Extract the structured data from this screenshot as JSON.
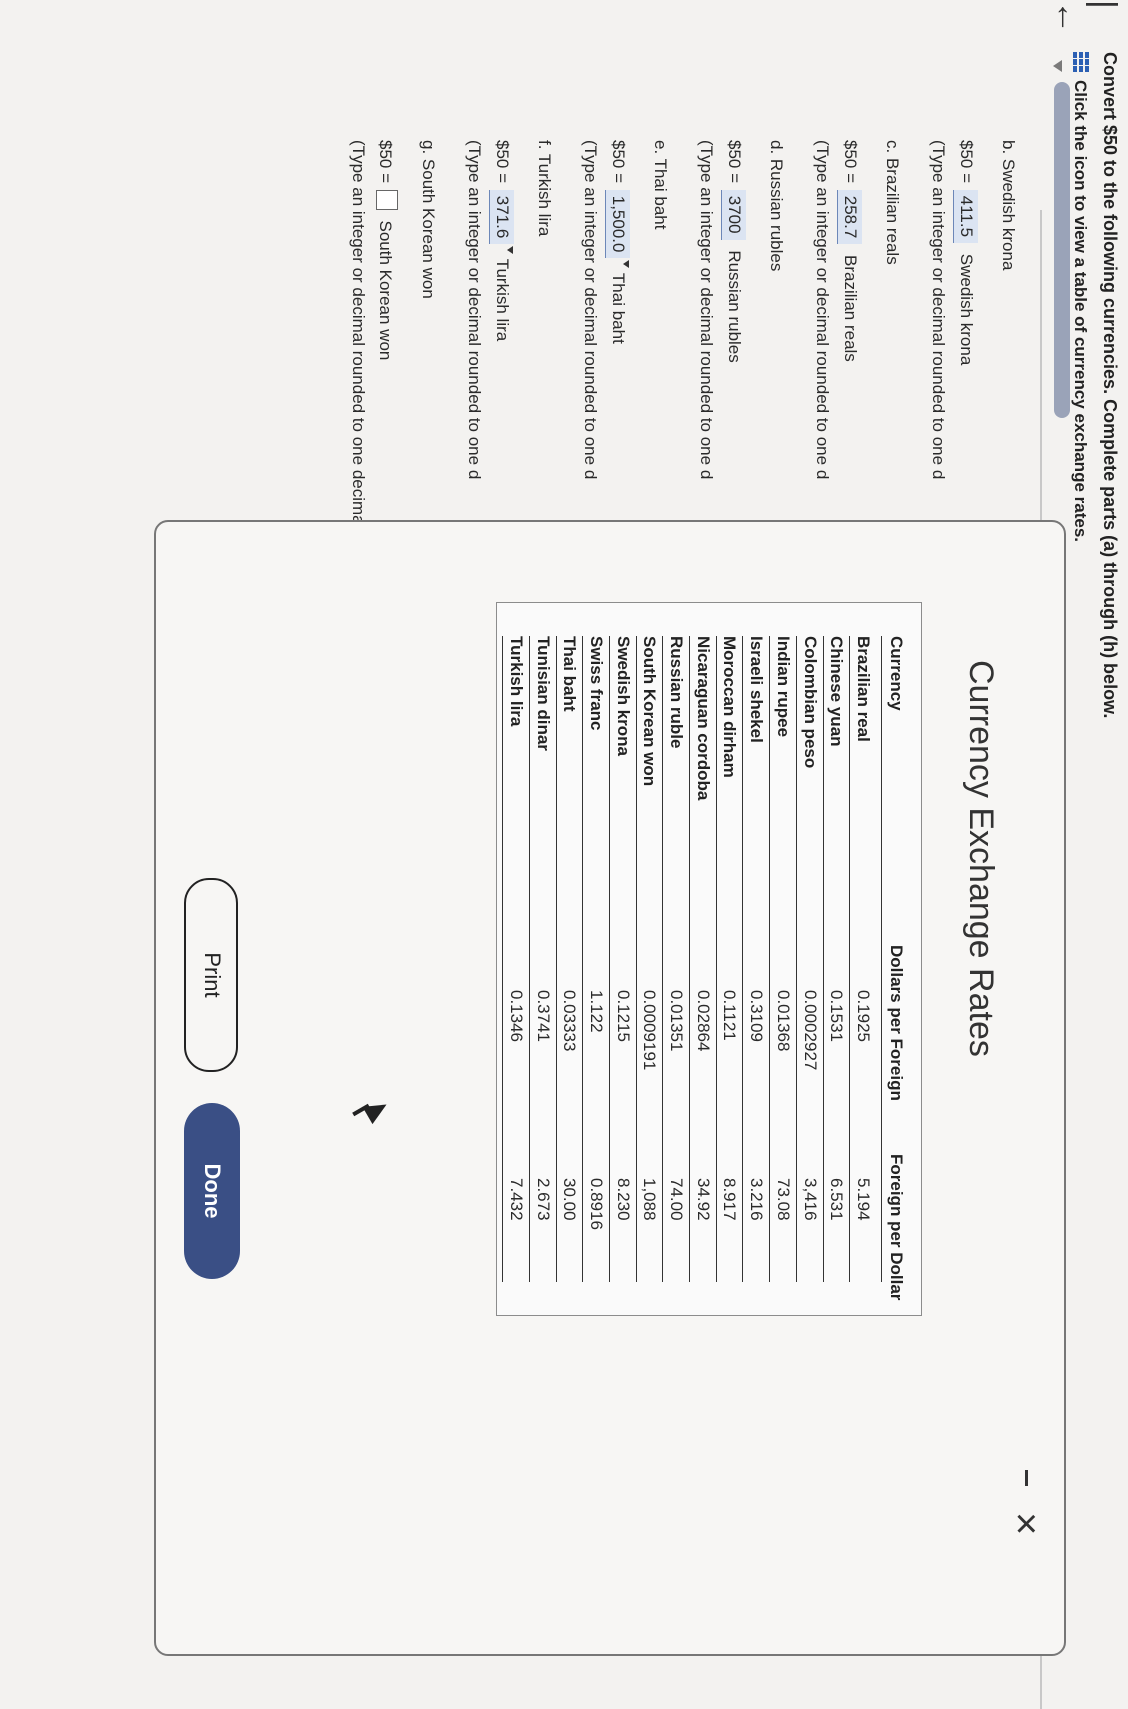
{
  "header": {
    "back_label": "|←",
    "question": "Convert $50 to the following currencies. Complete parts (a) through (h) below.",
    "hint": "Click the icon to view a table of currency exchange rates."
  },
  "parts": {
    "b": {
      "heading": "b. Swedish krona",
      "prefix": "$50 =",
      "answer": "411.5",
      "unit": "Swedish krona",
      "instruction": "(Type an integer or decimal rounded to one d"
    },
    "c": {
      "heading": "c. Brazilian reals",
      "prefix": "$50 =",
      "answer": "258.7",
      "unit": "Brazilian reals",
      "instruction": "(Type an integer or decimal rounded to one d"
    },
    "d": {
      "heading": "d. Russian rubles",
      "prefix": "$50 =",
      "answer": "3700",
      "unit": "Russian rubles",
      "instruction": "(Type an integer or decimal rounded to one d"
    },
    "e": {
      "heading": "e. Thai baht",
      "prefix": "$50 =",
      "answer": "1,500.0",
      "unit": "Thai baht",
      "instruction": "(Type an integer or decimal rounded to one d"
    },
    "f": {
      "heading": "f. Turkish lira",
      "prefix": "$50 =",
      "answer": "371.6",
      "unit": "Turkish lira",
      "instruction": "(Type an integer or decimal rounded to one d"
    },
    "g": {
      "heading": "g. South Korean won",
      "prefix": "$50 =",
      "answer": "",
      "unit": "South Korean won",
      "instruction": "(Type an integer or decimal rounded to one decimal place as needed.)"
    }
  },
  "popup": {
    "title": "Currency Exchange Rates",
    "minimize_label": "",
    "close_label": "×",
    "print_label": "Print",
    "done_label": "Done",
    "columns": [
      "Currency",
      "Dollars per Foreign",
      "Foreign per Dollar"
    ],
    "rows": [
      [
        "Brazilian real",
        "0.1925",
        "5.194"
      ],
      [
        "Chinese yuan",
        "0.1531",
        "6.531"
      ],
      [
        "Colombian peso",
        "0.0002927",
        "3,416"
      ],
      [
        "Indian rupee",
        "0.01368",
        "73.08"
      ],
      [
        "Israeli shekel",
        "0.3109",
        "3.216"
      ],
      [
        "Moroccan dirham",
        "0.1121",
        "8.917"
      ],
      [
        "Nicaraguan cordoba",
        "0.02864",
        "34.92"
      ],
      [
        "Russian ruble",
        "0.01351",
        "74.00"
      ],
      [
        "South Korean won",
        "0.0009191",
        "1,088"
      ],
      [
        "Swedish krona",
        "0.1215",
        "8.230"
      ],
      [
        "Swiss franc",
        "1.122",
        "0.8916"
      ],
      [
        "Thai baht",
        "0.03333",
        "30.00"
      ],
      [
        "Tunisian dinar",
        "0.3741",
        "2.673"
      ],
      [
        "Turkish lira",
        "0.1346",
        "7.432"
      ]
    ]
  },
  "colors": {
    "accent": "#3a4f85",
    "answer_bg": "#dbe4f2",
    "icon_blue": "#2b5fb3"
  }
}
